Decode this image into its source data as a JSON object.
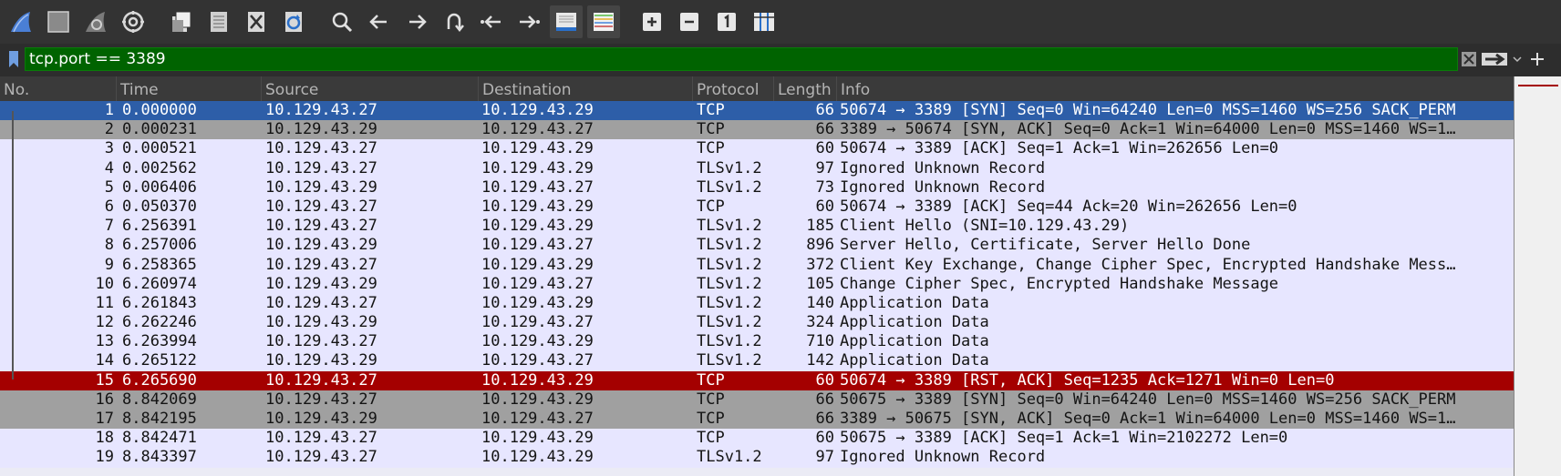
{
  "toolbar": {
    "icons": [
      "shark-fin-start-icon",
      "stop-capture-icon",
      "restart-capture-icon",
      "capture-options-icon",
      "open-file-icon",
      "save-file-icon",
      "close-file-icon",
      "reload-file-icon",
      "find-packet-icon",
      "go-back-icon",
      "go-forward-icon",
      "go-to-packet-icon",
      "first-packet-icon",
      "last-packet-icon",
      "autoscroll-icon",
      "colorize-icon",
      "zoom-in-icon",
      "zoom-out-icon",
      "normal-size-icon",
      "resize-columns-icon"
    ]
  },
  "filter": {
    "value": "tcp.port == 3389"
  },
  "columns": [
    "No.",
    "Time",
    "Source",
    "Destination",
    "Protocol",
    "Length",
    "Info"
  ],
  "packets": [
    {
      "no": "1",
      "time": "0.000000",
      "src": "10.129.43.27",
      "dst": "10.129.43.29",
      "proto": "TCP",
      "len": "66",
      "info": "50674 → 3389 [SYN] Seq=0 Win=64240 Len=0 MSS=1460 WS=256 SACK_PERM",
      "style": "bg-sel"
    },
    {
      "no": "2",
      "time": "0.000231",
      "src": "10.129.43.29",
      "dst": "10.129.43.27",
      "proto": "TCP",
      "len": "66",
      "info": "3389 → 50674 [SYN, ACK] Seq=0 Ack=1 Win=64000 Len=0 MSS=1460 WS=1…",
      "style": "bg-gray"
    },
    {
      "no": "3",
      "time": "0.000521",
      "src": "10.129.43.27",
      "dst": "10.129.43.29",
      "proto": "TCP",
      "len": "60",
      "info": "50674 → 3389 [ACK] Seq=1 Ack=1 Win=262656 Len=0",
      "style": "bg-light"
    },
    {
      "no": "4",
      "time": "0.002562",
      "src": "10.129.43.27",
      "dst": "10.129.43.29",
      "proto": "TLSv1.2",
      "len": "97",
      "info": "Ignored Unknown Record",
      "style": "bg-light"
    },
    {
      "no": "5",
      "time": "0.006406",
      "src": "10.129.43.29",
      "dst": "10.129.43.27",
      "proto": "TLSv1.2",
      "len": "73",
      "info": "Ignored Unknown Record",
      "style": "bg-light"
    },
    {
      "no": "6",
      "time": "0.050370",
      "src": "10.129.43.27",
      "dst": "10.129.43.29",
      "proto": "TCP",
      "len": "60",
      "info": "50674 → 3389 [ACK] Seq=44 Ack=20 Win=262656 Len=0",
      "style": "bg-light"
    },
    {
      "no": "7",
      "time": "6.256391",
      "src": "10.129.43.27",
      "dst": "10.129.43.29",
      "proto": "TLSv1.2",
      "len": "185",
      "info": "Client Hello (SNI=10.129.43.29)",
      "style": "bg-light"
    },
    {
      "no": "8",
      "time": "6.257006",
      "src": "10.129.43.29",
      "dst": "10.129.43.27",
      "proto": "TLSv1.2",
      "len": "896",
      "info": "Server Hello, Certificate, Server Hello Done",
      "style": "bg-light"
    },
    {
      "no": "9",
      "time": "6.258365",
      "src": "10.129.43.27",
      "dst": "10.129.43.29",
      "proto": "TLSv1.2",
      "len": "372",
      "info": "Client Key Exchange, Change Cipher Spec, Encrypted Handshake Mess…",
      "style": "bg-light"
    },
    {
      "no": "10",
      "time": "6.260974",
      "src": "10.129.43.29",
      "dst": "10.129.43.27",
      "proto": "TLSv1.2",
      "len": "105",
      "info": "Change Cipher Spec, Encrypted Handshake Message",
      "style": "bg-light"
    },
    {
      "no": "11",
      "time": "6.261843",
      "src": "10.129.43.27",
      "dst": "10.129.43.29",
      "proto": "TLSv1.2",
      "len": "140",
      "info": "Application Data",
      "style": "bg-light"
    },
    {
      "no": "12",
      "time": "6.262246",
      "src": "10.129.43.29",
      "dst": "10.129.43.27",
      "proto": "TLSv1.2",
      "len": "324",
      "info": "Application Data",
      "style": "bg-light"
    },
    {
      "no": "13",
      "time": "6.263994",
      "src": "10.129.43.27",
      "dst": "10.129.43.29",
      "proto": "TLSv1.2",
      "len": "710",
      "info": "Application Data",
      "style": "bg-light"
    },
    {
      "no": "14",
      "time": "6.265122",
      "src": "10.129.43.29",
      "dst": "10.129.43.27",
      "proto": "TLSv1.2",
      "len": "142",
      "info": "Application Data",
      "style": "bg-light"
    },
    {
      "no": "15",
      "time": "6.265690",
      "src": "10.129.43.27",
      "dst": "10.129.43.29",
      "proto": "TCP",
      "len": "60",
      "info": "50674 → 3389 [RST, ACK] Seq=1235 Ack=1271 Win=0 Len=0",
      "style": "bg-red"
    },
    {
      "no": "16",
      "time": "8.842069",
      "src": "10.129.43.27",
      "dst": "10.129.43.29",
      "proto": "TCP",
      "len": "66",
      "info": "50675 → 3389 [SYN] Seq=0 Win=64240 Len=0 MSS=1460 WS=256 SACK_PERM",
      "style": "bg-gray"
    },
    {
      "no": "17",
      "time": "8.842195",
      "src": "10.129.43.29",
      "dst": "10.129.43.27",
      "proto": "TCP",
      "len": "66",
      "info": "3389 → 50675 [SYN, ACK] Seq=0 Ack=1 Win=64000 Len=0 MSS=1460 WS=1…",
      "style": "bg-gray"
    },
    {
      "no": "18",
      "time": "8.842471",
      "src": "10.129.43.27",
      "dst": "10.129.43.29",
      "proto": "TCP",
      "len": "60",
      "info": "50675 → 3389 [ACK] Seq=1 Ack=1 Win=2102272 Len=0",
      "style": "bg-light"
    },
    {
      "no": "19",
      "time": "8.843397",
      "src": "10.129.43.27",
      "dst": "10.129.43.29",
      "proto": "TLSv1.2",
      "len": "97",
      "info": "Ignored Unknown Record",
      "style": "bg-light"
    }
  ],
  "colors": {
    "selected_row": "#2d5ea8",
    "rst_row": "#a40000",
    "syn_row": "#a0a0a0",
    "default_row": "#e7e6ff",
    "filter_valid": "#006300"
  }
}
